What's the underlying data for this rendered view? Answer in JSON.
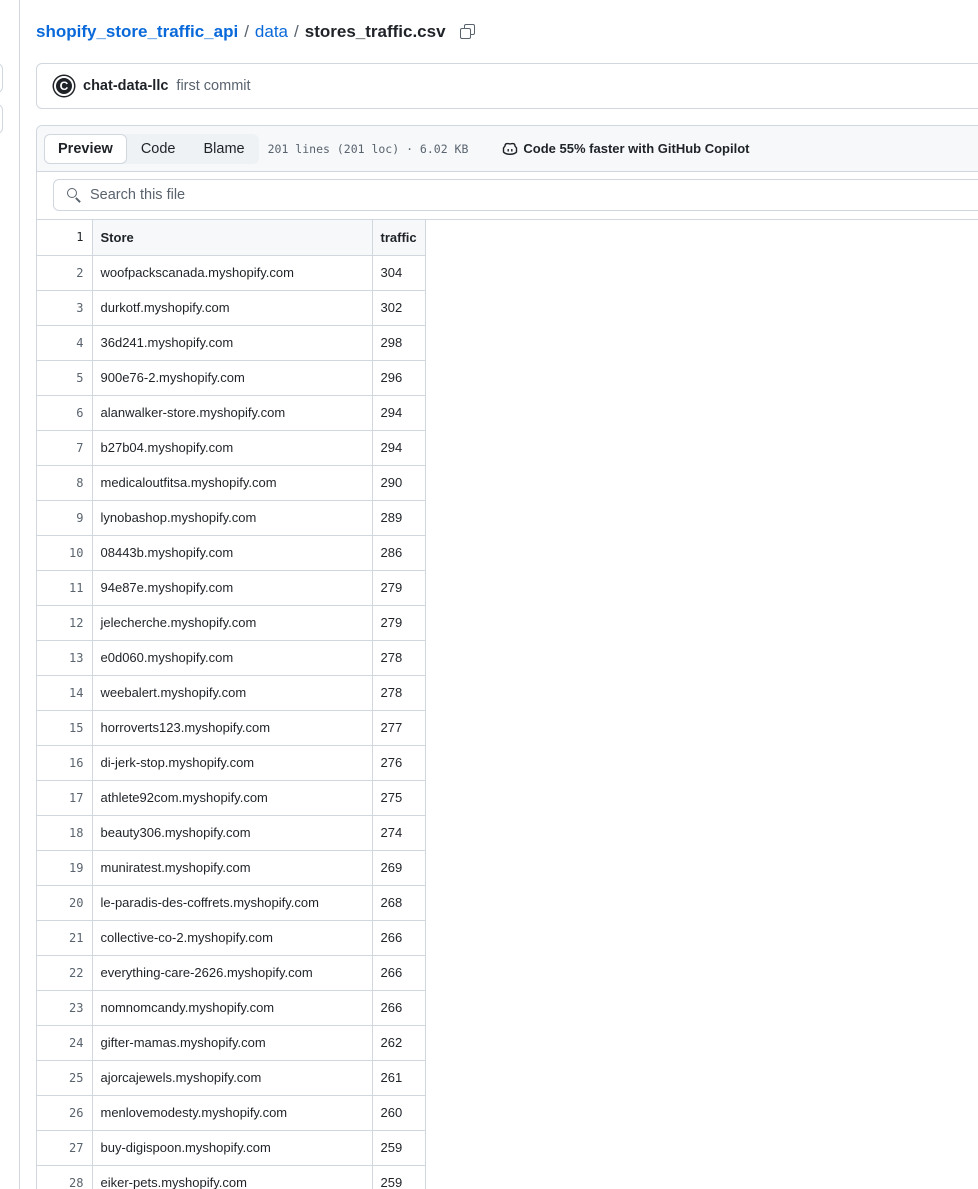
{
  "breadcrumb": {
    "repo": "shopify_store_traffic_api",
    "sep1": "/",
    "folder": "data",
    "sep2": "/",
    "file": "stores_traffic.csv"
  },
  "commit": {
    "avatar_letter": "C",
    "author": "chat-data-llc",
    "message": "first commit"
  },
  "file_header": {
    "tabs": [
      {
        "label": "Preview",
        "active": true
      },
      {
        "label": "Code",
        "active": false
      },
      {
        "label": "Blame",
        "active": false
      }
    ],
    "meta": "201 lines (201 loc) · 6.02 KB",
    "copilot_text": "Code 55% faster with GitHub Copilot"
  },
  "search": {
    "placeholder": "Search this file"
  },
  "table": {
    "header": {
      "line": "1",
      "store": "Store",
      "traffic": "traffic"
    },
    "rows": [
      {
        "line": "2",
        "store": "woofpackscanada.myshopify.com",
        "traffic": "304"
      },
      {
        "line": "3",
        "store": "durkotf.myshopify.com",
        "traffic": "302"
      },
      {
        "line": "4",
        "store": "36d241.myshopify.com",
        "traffic": "298"
      },
      {
        "line": "5",
        "store": "900e76-2.myshopify.com",
        "traffic": "296"
      },
      {
        "line": "6",
        "store": "alanwalker-store.myshopify.com",
        "traffic": "294"
      },
      {
        "line": "7",
        "store": "b27b04.myshopify.com",
        "traffic": "294"
      },
      {
        "line": "8",
        "store": "medicaloutfitsa.myshopify.com",
        "traffic": "290"
      },
      {
        "line": "9",
        "store": "lynobashop.myshopify.com",
        "traffic": "289"
      },
      {
        "line": "10",
        "store": "08443b.myshopify.com",
        "traffic": "286"
      },
      {
        "line": "11",
        "store": "94e87e.myshopify.com",
        "traffic": "279"
      },
      {
        "line": "12",
        "store": "jelecherche.myshopify.com",
        "traffic": "279"
      },
      {
        "line": "13",
        "store": "e0d060.myshopify.com",
        "traffic": "278"
      },
      {
        "line": "14",
        "store": "weebalert.myshopify.com",
        "traffic": "278"
      },
      {
        "line": "15",
        "store": "horroverts123.myshopify.com",
        "traffic": "277"
      },
      {
        "line": "16",
        "store": "di-jerk-stop.myshopify.com",
        "traffic": "276"
      },
      {
        "line": "17",
        "store": "athlete92com.myshopify.com",
        "traffic": "275"
      },
      {
        "line": "18",
        "store": "beauty306.myshopify.com",
        "traffic": "274"
      },
      {
        "line": "19",
        "store": "muniratest.myshopify.com",
        "traffic": "269"
      },
      {
        "line": "20",
        "store": "le-paradis-des-coffrets.myshopify.com",
        "traffic": "268"
      },
      {
        "line": "21",
        "store": "collective-co-2.myshopify.com",
        "traffic": "266"
      },
      {
        "line": "22",
        "store": "everything-care-2626.myshopify.com",
        "traffic": "266"
      },
      {
        "line": "23",
        "store": "nomnomcandy.myshopify.com",
        "traffic": "266"
      },
      {
        "line": "24",
        "store": "gifter-mamas.myshopify.com",
        "traffic": "262"
      },
      {
        "line": "25",
        "store": "ajorcajewels.myshopify.com",
        "traffic": "261"
      },
      {
        "line": "26",
        "store": "menlovemodesty.myshopify.com",
        "traffic": "260"
      },
      {
        "line": "27",
        "store": "buy-digispoon.myshopify.com",
        "traffic": "259"
      },
      {
        "line": "28",
        "store": "eiker-pets.myshopify.com",
        "traffic": "259"
      }
    ]
  },
  "colors": {
    "link": "#0969da",
    "border": "#d0d7de",
    "muted": "#59636e",
    "header_bg": "#f6f8fa"
  },
  "icons": [
    "copy-icon",
    "avatar",
    "copilot-icon",
    "search-icon"
  ]
}
